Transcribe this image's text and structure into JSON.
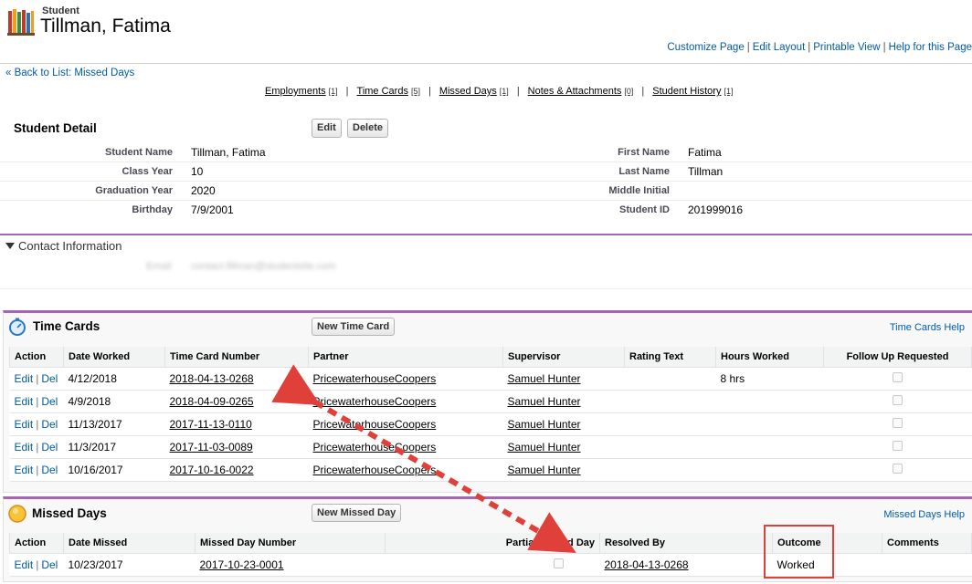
{
  "header": {
    "object_type": "Student",
    "record_name": "Tillman, Fatima",
    "links": [
      "Customize Page",
      "Edit Layout",
      "Printable View",
      "Help for this Page"
    ]
  },
  "back_link": "« Back to List: Missed Days",
  "related_links": [
    {
      "label": "Employments",
      "count": "[1]"
    },
    {
      "label": "Time Cards",
      "count": "[5]"
    },
    {
      "label": "Missed Days",
      "count": "[1]"
    },
    {
      "label": "Notes & Attachments",
      "count": "[0]"
    },
    {
      "label": "Student History",
      "count": "[1]"
    }
  ],
  "detail": {
    "title": "Student Detail",
    "edit_label": "Edit",
    "delete_label": "Delete",
    "left": [
      {
        "label": "Student Name",
        "value": "Tillman, Fatima"
      },
      {
        "label": "Class Year",
        "value": "10"
      },
      {
        "label": "Graduation Year",
        "value": "2020"
      },
      {
        "label": "Birthday",
        "value": "7/9/2001"
      }
    ],
    "right": [
      {
        "label": "First Name",
        "value": "Fatima"
      },
      {
        "label": "Last Name",
        "value": "Tillman"
      },
      {
        "label": "Middle Initial",
        "value": ""
      },
      {
        "label": "Student ID",
        "value": "201999016"
      }
    ]
  },
  "contact": {
    "title": "Contact Information",
    "blurred_label": "Email",
    "blurred_value": "contact.fillman@studentsite.com"
  },
  "time_cards": {
    "title": "Time Cards",
    "new_button": "New Time Card",
    "help": "Time Cards Help",
    "columns": [
      "Action",
      "Date Worked",
      "Time Card Number",
      "Partner",
      "Supervisor",
      "Rating Text",
      "Hours Worked",
      "Follow Up Requested"
    ],
    "action_edit": "Edit",
    "action_del": "Del",
    "rows": [
      {
        "date": "4/12/2018",
        "number": "2018-04-13-0268",
        "partner": "PricewaterhouseCoopers",
        "supervisor": "Samuel Hunter",
        "rating": "",
        "hours": "8 hrs"
      },
      {
        "date": "4/9/2018",
        "number": "2018-04-09-0265",
        "partner": "PricewaterhouseCoopers",
        "supervisor": "Samuel Hunter",
        "rating": "",
        "hours": ""
      },
      {
        "date": "11/13/2017",
        "number": "2017-11-13-0110",
        "partner": "PricewaterhouseCoopers",
        "supervisor": "Samuel Hunter",
        "rating": "",
        "hours": ""
      },
      {
        "date": "11/3/2017",
        "number": "2017-11-03-0089",
        "partner": "PricewaterhouseCoopers",
        "supervisor": "Samuel Hunter",
        "rating": "",
        "hours": ""
      },
      {
        "date": "10/16/2017",
        "number": "2017-10-16-0022",
        "partner": "PricewaterhouseCoopers",
        "supervisor": "Samuel Hunter",
        "rating": "",
        "hours": ""
      }
    ]
  },
  "missed_days": {
    "title": "Missed Days",
    "new_button": "New Missed Day",
    "help": "Missed Days Help",
    "columns": [
      "Action",
      "Date Missed",
      "Missed Day Number",
      "Partial Missed Day",
      "Resolved By",
      "Outcome",
      "Comments"
    ],
    "rows": [
      {
        "date": "10/23/2017",
        "number": "2017-10-23-0001",
        "resolved_by": "2018-04-13-0268",
        "outcome": "Worked",
        "comments": ""
      }
    ]
  },
  "colors": {
    "accent": "#a565b3",
    "link": "#015ba7",
    "annotation": "#e0403a"
  }
}
